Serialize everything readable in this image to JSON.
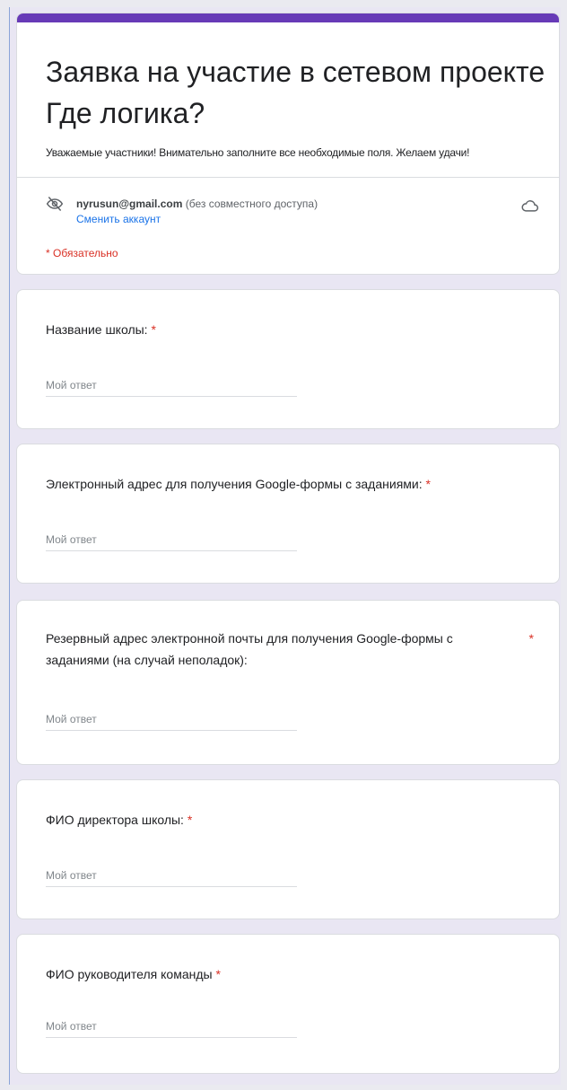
{
  "form": {
    "title": "Заявка на участие в сетевом проекте\n Где логика?",
    "description": "Уважаемые участники! Внимательно заполните все необходимые поля. Желаем удачи!",
    "account_email": "nyrusun@gmail.com",
    "account_note": "(без совместного доступа)",
    "switch_account": "Сменить аккаунт",
    "required_note": "* Обязательно",
    "accent_color": "#673ab7",
    "icons": {
      "hidden": "eye-off-icon",
      "cloud": "cloud-done-icon"
    }
  },
  "questions": [
    {
      "label": "Название школы:",
      "star": "*",
      "placeholder": "Мой ответ"
    },
    {
      "label": "Электронный адрес для получения Google-формы с заданиями:",
      "star": "*",
      "placeholder": "Мой ответ"
    },
    {
      "label": "Резервный адрес электронной почты для получения Google-формы с заданиями (на случай неполадок):",
      "star": "*",
      "placeholder": "Мой ответ"
    },
    {
      "label": "ФИО директора школы:",
      "star": "*",
      "placeholder": "Мой ответ"
    },
    {
      "label": "ФИО руководителя команды",
      "star": "*",
      "placeholder": "Мой ответ"
    }
  ]
}
